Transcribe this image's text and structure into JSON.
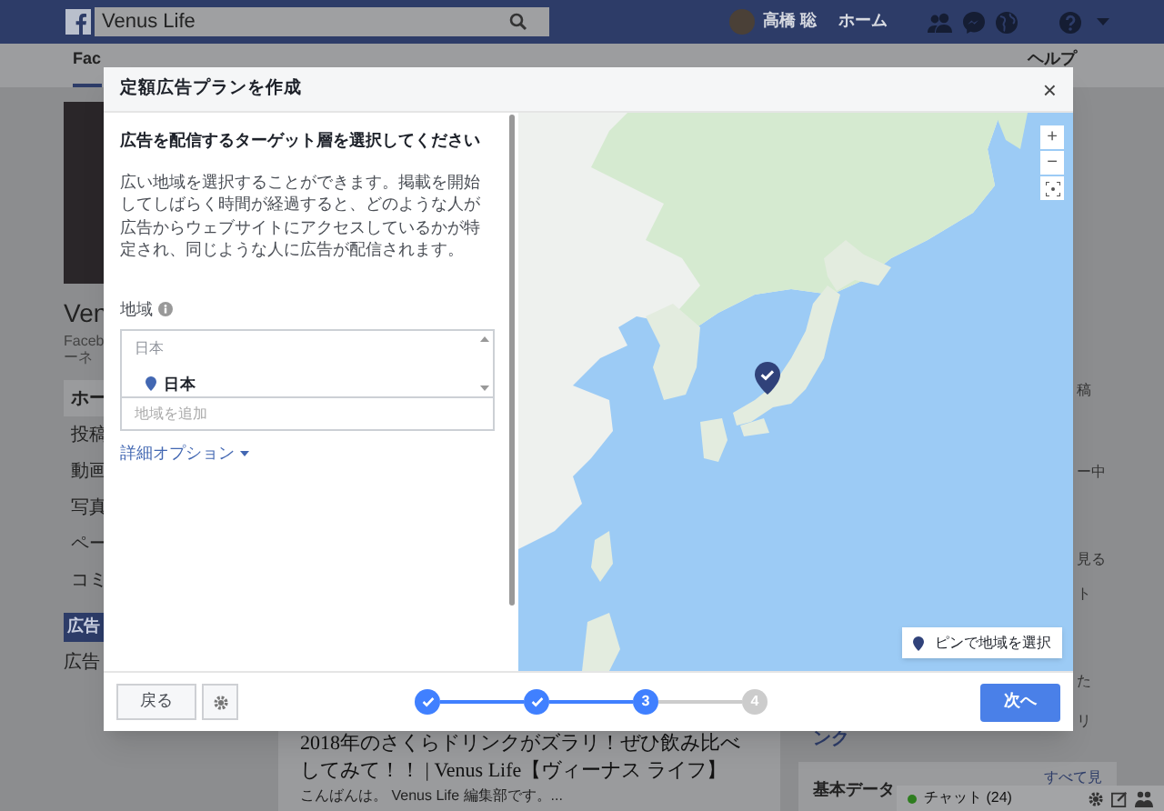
{
  "top_bar": {
    "search_value": "Venus Life",
    "user_name": "高橋 聡",
    "home_link": "ホーム"
  },
  "page_nav": {
    "tabs": [
      {
        "label": "Fac",
        "selected": true
      },
      {
        "label": "ヘルプ",
        "selected": false
      }
    ]
  },
  "left_sidebar": {
    "page_name": "Ven",
    "subtitle_lines": [
      "Faceb",
      "ーネ"
    ],
    "items": [
      {
        "label": "ホー",
        "selected": true
      },
      {
        "label": "投稿",
        "selected": false
      },
      {
        "label": "動画",
        "selected": false
      },
      {
        "label": "写真",
        "selected": false
      },
      {
        "label": "ペー",
        "selected": false
      },
      {
        "label": "コミ",
        "selected": false
      }
    ],
    "promote_button": "広告",
    "ad_link": "広告"
  },
  "feed": {
    "article_title": "2018年のさくらドリンクがズラリ！ぜひ飲み比べしてみて！！ | Venus Life【ヴィーナス ライフ】",
    "article_excerpt": "こんばんは。 Venus Life 編集部です。..."
  },
  "right_column": {
    "fragments": [
      "稿",
      "ー中",
      "見る",
      "ト",
      "た",
      "リ"
    ],
    "link_fragment": "ンク",
    "section_title": "基本データ",
    "see_all": "すべて見"
  },
  "chat_bar": {
    "label": "チャット (24)",
    "online": true
  },
  "modal": {
    "title": "定額広告プランを作成",
    "close": "×",
    "heading": "広告を配信するターゲット層を選択してください",
    "description": "広い地域を選択することができます。掲載を開始してしばらく時間が経過すると、どのような人が広告からウェブサイトにアクセスしているかが特定され、同じような人に広告が配信されます。",
    "region_label": "地域",
    "locations": {
      "group_label": "日本",
      "items": [
        {
          "label": "日本"
        }
      ],
      "placeholder": "地域を追加"
    },
    "advanced_options": "詳細オプション",
    "map": {
      "zoom_in": "+",
      "zoom_out": "−",
      "pin_button": "ピンで地域を選択"
    },
    "footer": {
      "back_button": "戻る",
      "steps": [
        {
          "kind": "done"
        },
        {
          "kind": "done"
        },
        {
          "kind": "current",
          "label": "3"
        },
        {
          "kind": "upcoming",
          "label": "4"
        }
      ],
      "next_button": "次へ"
    }
  }
}
